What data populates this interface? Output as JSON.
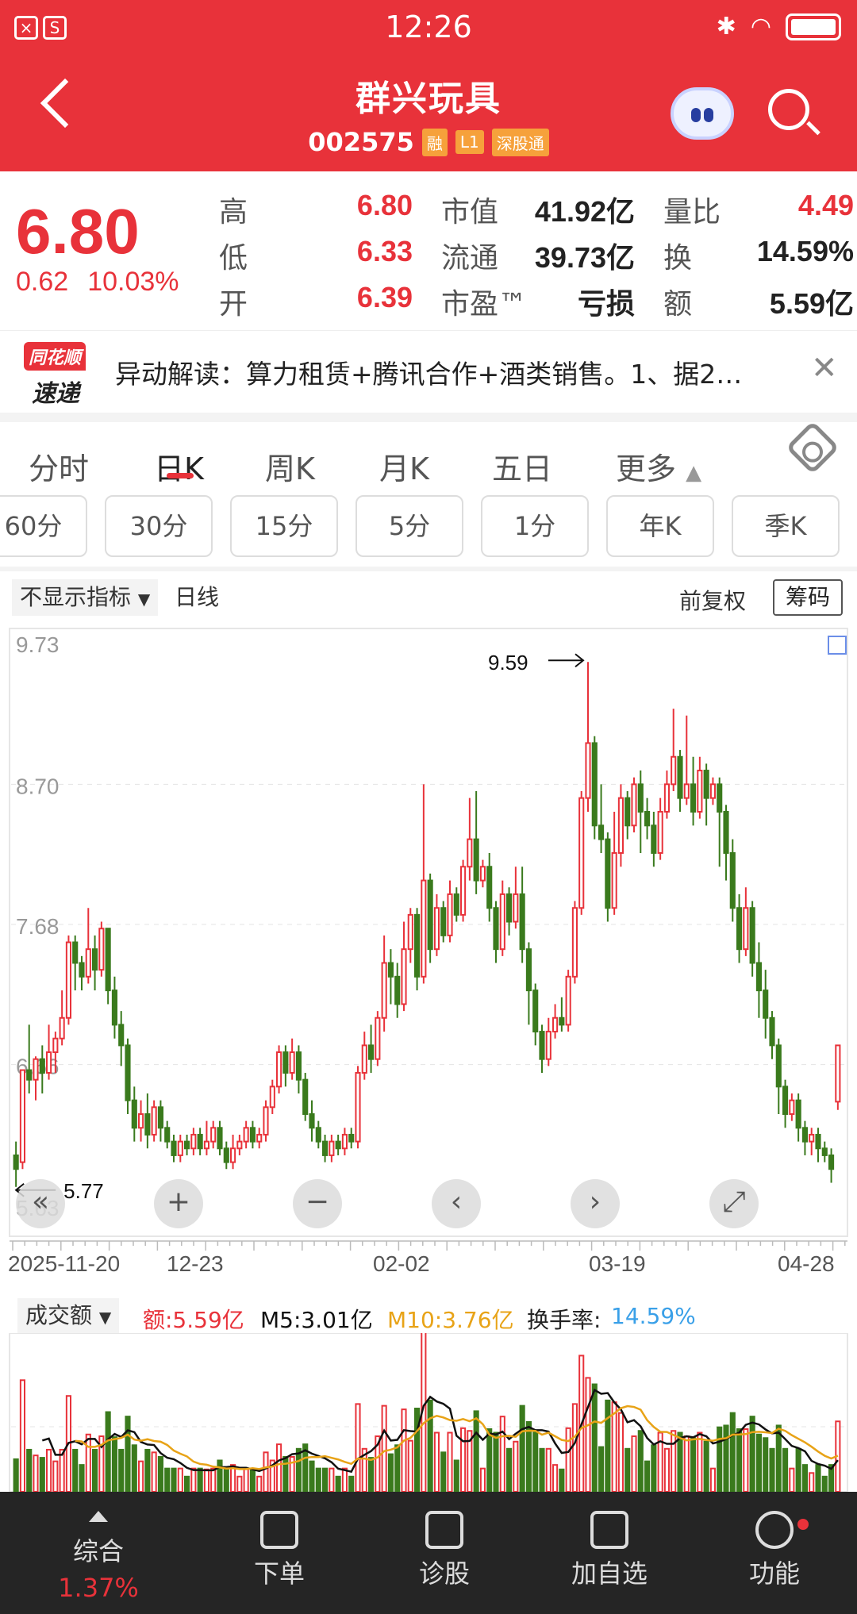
{
  "status_bar": {
    "time": "12:26"
  },
  "header": {
    "name": "群兴玩具",
    "code": "002575",
    "tags": [
      "融",
      "L1",
      "深股通"
    ]
  },
  "quote": {
    "price": "6.80",
    "change": "0.62",
    "change_pct": "10.03%",
    "high": {
      "label": "高",
      "value": "6.80"
    },
    "low": {
      "label": "低",
      "value": "6.33"
    },
    "open": {
      "label": "开",
      "value": "6.39"
    },
    "mkt_cap": {
      "label": "市值",
      "value": "41.92亿"
    },
    "float_cap": {
      "label": "流通",
      "value": "39.73亿"
    },
    "pe": {
      "label": "市盈™",
      "value": "亏损"
    },
    "vol_ratio": {
      "label": "量比",
      "value": "4.49"
    },
    "turnover": {
      "label": "换",
      "value": "14.59%"
    },
    "amount": {
      "label": "额",
      "value": "5.59亿"
    }
  },
  "news": {
    "logo_top": "同花顺",
    "logo_bottom": "速递",
    "text": "异动解读：算力租赁+腾讯合作+酒类销售。1、据2…"
  },
  "tabs": [
    "分时",
    "日K",
    "周K",
    "月K",
    "五日",
    "更多"
  ],
  "active_tab": "日K",
  "sub_tabs": [
    "60分",
    "30分",
    "15分",
    "5分",
    "1分",
    "年K",
    "季K"
  ],
  "chart_options": {
    "indicator": "不显示指标",
    "line_type": "日线",
    "adjust": "前复权",
    "chips": "筹码"
  },
  "chart_data": {
    "type": "candlestick",
    "y_ticks": [
      "9.73",
      "8.70",
      "7.68",
      "6.66",
      "5.63"
    ],
    "ylim": [
      5.63,
      9.73
    ],
    "x_ticks": [
      "2025-11-20",
      "12-23",
      "02-02",
      "03-19",
      "04-28"
    ],
    "max_label": "9.59",
    "min_label": "5.77",
    "candles": [
      [
        6.0,
        5.9,
        6.1,
        5.77
      ],
      [
        5.95,
        6.62,
        6.62,
        5.9
      ],
      [
        6.62,
        6.55,
        6.95,
        6.45
      ],
      [
        6.55,
        6.7,
        6.72,
        6.4
      ],
      [
        6.7,
        6.6,
        6.8,
        6.45
      ],
      [
        6.6,
        6.75,
        6.95,
        6.55
      ],
      [
        6.75,
        6.85,
        6.9,
        6.6
      ],
      [
        6.85,
        7.0,
        7.2,
        6.8
      ],
      [
        7.0,
        7.55,
        7.6,
        6.95
      ],
      [
        7.55,
        7.4,
        7.6,
        7.2
      ],
      [
        7.4,
        7.3,
        7.45,
        7.2
      ],
      [
        7.3,
        7.5,
        7.8,
        7.25
      ],
      [
        7.5,
        7.35,
        7.6,
        7.2
      ],
      [
        7.35,
        7.65,
        7.7,
        7.3
      ],
      [
        7.65,
        7.2,
        7.65,
        7.1
      ],
      [
        7.2,
        6.95,
        7.3,
        6.85
      ],
      [
        6.95,
        6.8,
        7.05,
        6.65
      ],
      [
        6.8,
        6.4,
        6.85,
        6.3
      ],
      [
        6.4,
        6.2,
        6.5,
        6.1
      ],
      [
        6.2,
        6.3,
        6.4,
        6.1
      ],
      [
        6.3,
        6.15,
        6.45,
        6.05
      ],
      [
        6.15,
        6.35,
        6.4,
        6.1
      ],
      [
        6.35,
        6.2,
        6.4,
        6.1
      ],
      [
        6.2,
        6.1,
        6.25,
        6.05
      ],
      [
        6.1,
        6.0,
        6.15,
        5.95
      ],
      [
        6.0,
        6.1,
        6.15,
        5.95
      ],
      [
        6.1,
        6.05,
        6.15,
        6.0
      ],
      [
        6.05,
        6.15,
        6.2,
        6.0
      ],
      [
        6.15,
        6.05,
        6.2,
        6.0
      ],
      [
        6.05,
        6.1,
        6.25,
        6.0
      ],
      [
        6.1,
        6.2,
        6.25,
        6.05
      ],
      [
        6.2,
        6.05,
        6.25,
        6.0
      ],
      [
        6.05,
        5.95,
        6.1,
        5.9
      ],
      [
        5.95,
        6.05,
        6.15,
        5.9
      ],
      [
        6.05,
        6.1,
        6.15,
        6.0
      ],
      [
        6.1,
        6.2,
        6.25,
        6.05
      ],
      [
        6.2,
        6.1,
        6.25,
        6.05
      ],
      [
        6.1,
        6.15,
        6.2,
        6.05
      ],
      [
        6.15,
        6.35,
        6.4,
        6.1
      ],
      [
        6.35,
        6.5,
        6.55,
        6.3
      ],
      [
        6.5,
        6.75,
        6.8,
        6.45
      ],
      [
        6.75,
        6.6,
        6.8,
        6.5
      ],
      [
        6.6,
        6.75,
        6.85,
        6.55
      ],
      [
        6.75,
        6.55,
        6.8,
        6.45
      ],
      [
        6.55,
        6.3,
        6.6,
        6.25
      ],
      [
        6.3,
        6.2,
        6.4,
        6.1
      ],
      [
        6.2,
        6.1,
        6.25,
        6.05
      ],
      [
        6.1,
        6.0,
        6.15,
        5.95
      ],
      [
        6.0,
        6.1,
        6.15,
        5.95
      ],
      [
        6.1,
        6.05,
        6.15,
        6.0
      ],
      [
        6.05,
        6.15,
        6.2,
        6.0
      ],
      [
        6.15,
        6.1,
        6.2,
        6.05
      ],
      [
        6.1,
        6.6,
        6.65,
        6.05
      ],
      [
        6.6,
        6.8,
        6.9,
        6.55
      ],
      [
        6.8,
        6.7,
        6.95,
        6.6
      ],
      [
        6.7,
        7.0,
        7.05,
        6.65
      ],
      [
        7.0,
        7.4,
        7.6,
        6.9
      ],
      [
        7.4,
        7.3,
        7.5,
        7.1
      ],
      [
        7.3,
        7.1,
        7.4,
        7.0
      ],
      [
        7.1,
        7.5,
        7.7,
        7.05
      ],
      [
        7.5,
        7.75,
        7.8,
        7.4
      ],
      [
        7.75,
        7.3,
        7.8,
        7.2
      ],
      [
        7.3,
        8.0,
        8.7,
        7.25
      ],
      [
        8.0,
        7.5,
        8.05,
        7.4
      ],
      [
        7.5,
        7.8,
        7.9,
        7.45
      ],
      [
        7.8,
        7.6,
        7.85,
        7.55
      ],
      [
        7.6,
        7.9,
        8.0,
        7.55
      ],
      [
        7.9,
        7.75,
        7.95,
        7.7
      ],
      [
        7.75,
        8.1,
        8.15,
        7.7
      ],
      [
        8.1,
        8.3,
        8.6,
        8.0
      ],
      [
        8.3,
        8.0,
        8.65,
        7.9
      ],
      [
        8.0,
        8.1,
        8.15,
        7.95
      ],
      [
        8.1,
        7.8,
        8.2,
        7.7
      ],
      [
        7.8,
        7.5,
        7.85,
        7.4
      ],
      [
        7.5,
        7.9,
        8.0,
        7.45
      ],
      [
        7.9,
        7.7,
        7.95,
        7.6
      ],
      [
        7.7,
        7.9,
        8.1,
        7.65
      ],
      [
        7.9,
        7.5,
        8.1,
        7.4
      ],
      [
        7.5,
        7.2,
        7.55,
        6.95
      ],
      [
        7.2,
        6.9,
        7.25,
        6.8
      ],
      [
        6.9,
        6.7,
        6.95,
        6.6
      ],
      [
        6.7,
        6.9,
        7.0,
        6.65
      ],
      [
        6.9,
        7.0,
        7.1,
        6.85
      ],
      [
        7.0,
        6.95,
        7.15,
        6.9
      ],
      [
        6.95,
        7.3,
        7.35,
        6.9
      ],
      [
        7.3,
        7.8,
        7.85,
        7.25
      ],
      [
        7.8,
        8.6,
        8.65,
        7.75
      ],
      [
        8.6,
        9.0,
        9.59,
        8.5
      ],
      [
        9.0,
        8.4,
        9.05,
        8.3
      ],
      [
        8.4,
        8.3,
        8.7,
        8.2
      ],
      [
        8.3,
        7.8,
        8.35,
        7.7
      ],
      [
        7.8,
        8.2,
        8.5,
        7.75
      ],
      [
        8.2,
        8.6,
        8.7,
        8.1
      ],
      [
        8.6,
        8.4,
        8.65,
        8.3
      ],
      [
        8.4,
        8.7,
        8.75,
        8.35
      ],
      [
        8.7,
        8.5,
        8.8,
        8.2
      ],
      [
        8.5,
        8.4,
        8.6,
        8.3
      ],
      [
        8.4,
        8.2,
        8.5,
        8.1
      ],
      [
        8.2,
        8.5,
        8.6,
        8.15
      ],
      [
        8.5,
        8.7,
        8.8,
        8.45
      ],
      [
        8.7,
        8.9,
        9.25,
        8.65
      ],
      [
        8.9,
        8.6,
        8.95,
        8.5
      ],
      [
        8.6,
        8.7,
        9.2,
        8.55
      ],
      [
        8.7,
        8.5,
        8.9,
        8.4
      ],
      [
        8.5,
        8.8,
        8.9,
        8.45
      ],
      [
        8.8,
        8.6,
        8.85,
        8.4
      ],
      [
        8.6,
        8.7,
        8.75,
        8.55
      ],
      [
        8.7,
        8.5,
        8.75,
        8.1
      ],
      [
        8.5,
        8.2,
        8.55,
        8.0
      ],
      [
        8.2,
        7.8,
        8.3,
        7.7
      ],
      [
        7.8,
        7.5,
        7.9,
        7.4
      ],
      [
        7.5,
        7.8,
        7.95,
        7.45
      ],
      [
        7.8,
        7.4,
        7.85,
        7.3
      ],
      [
        7.4,
        7.2,
        7.55,
        7.0
      ],
      [
        7.2,
        7.0,
        7.35,
        6.85
      ],
      [
        7.0,
        6.8,
        7.05,
        6.7
      ],
      [
        6.8,
        6.5,
        6.85,
        6.3
      ],
      [
        6.5,
        6.3,
        6.55,
        6.2
      ],
      [
        6.3,
        6.4,
        6.45,
        6.25
      ],
      [
        6.4,
        6.2,
        6.45,
        6.1
      ],
      [
        6.2,
        6.1,
        6.25,
        6.0
      ],
      [
        6.1,
        6.15,
        6.2,
        6.0
      ],
      [
        6.15,
        6.05,
        6.2,
        5.95
      ],
      [
        6.05,
        6.0,
        6.1,
        5.95
      ],
      [
        6.0,
        5.9,
        6.05,
        5.8
      ],
      [
        6.39,
        6.8,
        6.8,
        6.33
      ]
    ]
  },
  "volume": {
    "selector": "成交额",
    "amount": "额:5.59亿",
    "m5": "M5:3.01亿",
    "m10": "M10:3.76亿",
    "turnover_label": "换手率:",
    "turnover": "14.59%"
  },
  "bottom_nav": {
    "items": [
      "综合",
      "下单",
      "诊股",
      "加自选",
      "功能"
    ],
    "first_sub": "1.37%"
  },
  "colors": {
    "up": "#e8323a",
    "down": "#3a7a1d",
    "ma5": "#111111",
    "ma10": "#e8a317",
    "turnover": "#3aa0e8"
  }
}
